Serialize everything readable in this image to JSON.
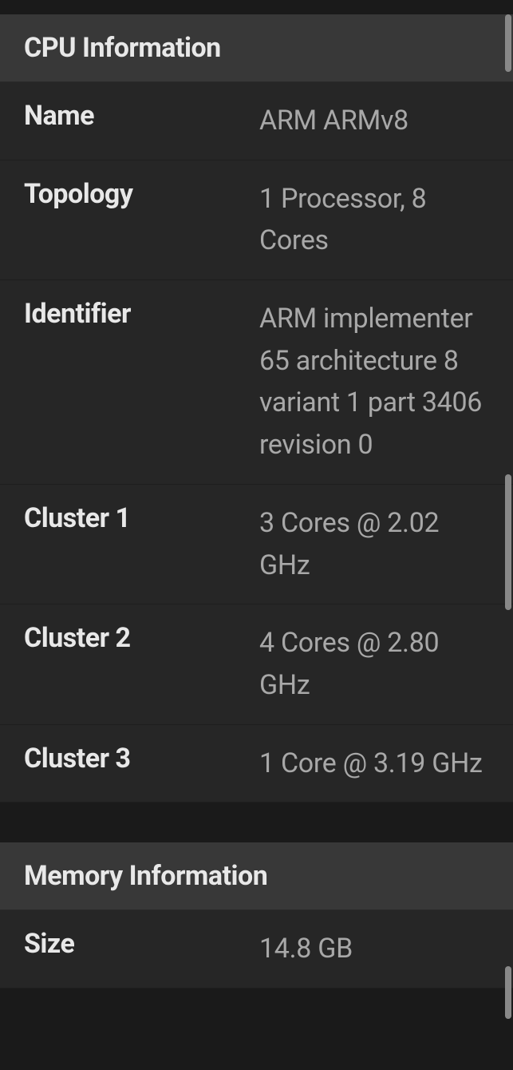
{
  "sections": {
    "cpu": {
      "title": "CPU Information",
      "rows": {
        "name": {
          "label": "Name",
          "value": "ARM ARMv8"
        },
        "topology": {
          "label": "Topology",
          "value": "1 Processor, 8 Cores"
        },
        "identifier": {
          "label": "Identifier",
          "value": "ARM implementer 65 architecture 8 variant 1 part 3406 revision 0"
        },
        "cluster1": {
          "label": "Cluster 1",
          "value": "3 Cores @ 2.02 GHz"
        },
        "cluster2": {
          "label": "Cluster 2",
          "value": "4 Cores @ 2.80 GHz"
        },
        "cluster3": {
          "label": "Cluster 3",
          "value": "1 Core @ 3.19 GHz"
        }
      }
    },
    "memory": {
      "title": "Memory Information",
      "rows": {
        "size": {
          "label": "Size",
          "value": "14.8 GB"
        }
      }
    }
  }
}
